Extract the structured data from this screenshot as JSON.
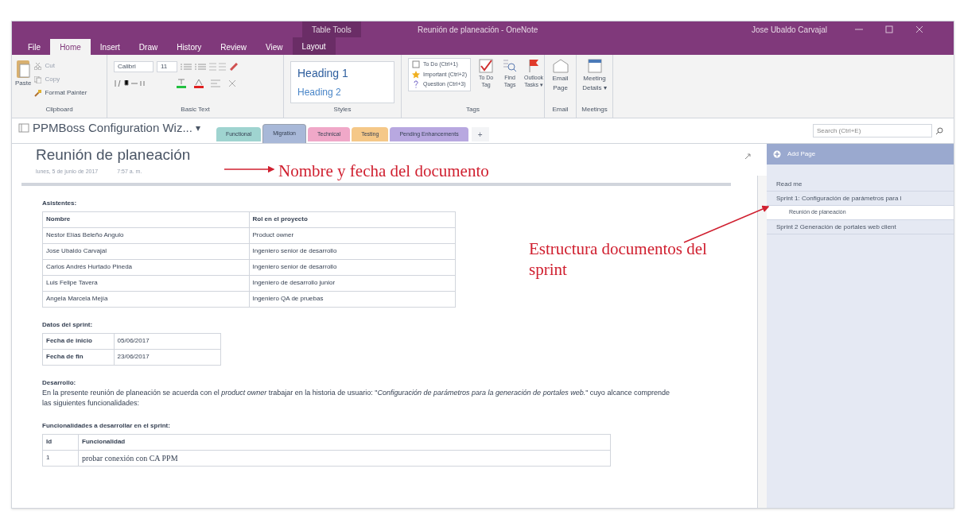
{
  "window": {
    "title": "Reunión de planeación - OneNote",
    "context_group": "Table Tools",
    "user": "Jose Ubaldo Carvajal"
  },
  "ribbon_tabs": [
    {
      "label": "File",
      "selected": false
    },
    {
      "label": "Home",
      "selected": true
    },
    {
      "label": "Insert",
      "selected": false
    },
    {
      "label": "Draw",
      "selected": false
    },
    {
      "label": "History",
      "selected": false
    },
    {
      "label": "Review",
      "selected": false
    },
    {
      "label": "View",
      "selected": false
    },
    {
      "label": "Layout",
      "selected": false
    }
  ],
  "ribbon": {
    "clipboard": {
      "paste": "Paste",
      "cut": "Cut",
      "copy": "Copy",
      "format_painter": "Format Painter",
      "label": "Clipboard"
    },
    "basic_text": {
      "font": "Calibri",
      "size": "11",
      "label": "Basic Text"
    },
    "styles": {
      "items": [
        "Heading 1",
        "Heading 2"
      ],
      "label": "Styles"
    },
    "tags": {
      "items": [
        {
          "kind": "todo",
          "label": "To Do (Ctrl+1)"
        },
        {
          "kind": "important",
          "label": "Important (Ctrl+2)"
        },
        {
          "kind": "question",
          "label": "Question (Ctrl+3)"
        }
      ],
      "buttons": [
        {
          "kind": "todo",
          "label": "To Do Tag"
        },
        {
          "kind": "find",
          "label": "Find Tags"
        },
        {
          "kind": "flag",
          "label": "Outlook Tasks ▾"
        }
      ],
      "label": "Tags"
    },
    "email": {
      "button": "Email Page",
      "label": "Email"
    },
    "meetings": {
      "button": "Meeting Details ▾",
      "label": "Meetings"
    }
  },
  "notebook": {
    "name": "PPMBoss Configuration Wiz...",
    "dropdown": "▾",
    "sections": [
      {
        "label": "Functional",
        "color": "#9fd4d0",
        "selected": false
      },
      {
        "label": "Migration",
        "color": "#a8b8d8",
        "selected": true
      },
      {
        "label": "Technical",
        "color": "#f0a8c8",
        "selected": false
      },
      {
        "label": "Testing",
        "color": "#f5c888",
        "selected": false
      },
      {
        "label": "Pending Enhancements",
        "color": "#b8a8e0",
        "selected": false
      }
    ],
    "add_section": "+",
    "search_placeholder": "Search (Ctrl+E)"
  },
  "page": {
    "title": "Reunión de planeación",
    "date": "lunes, 5 de junio de 2017",
    "time": "7:57 a. m.",
    "attendees_heading": "Asistentes:",
    "attendees_columns": [
      "Nombre",
      "Rol en el proyecto"
    ],
    "attendees": [
      [
        "Nestor Elías Beleño Angulo",
        "Product owner"
      ],
      [
        "Jose Ubaldo Carvajal",
        "Ingeniero senior de desarrollo"
      ],
      [
        "Carlos Andrés Hurtado Pineda",
        "Ingeniero senior de desarrollo"
      ],
      [
        "Luis Felipe Tavera",
        "Ingeniero de desarrollo junior"
      ],
      [
        "Angela Marcela Mejía",
        "Ingeniero QA de pruebas"
      ]
    ],
    "sprint_heading": "Datos del sprint:",
    "sprint_rows": [
      [
        "Fecha de inicio",
        "05/06/2017"
      ],
      [
        "Fecha de fin",
        "23/06/2017"
      ]
    ],
    "development_heading": "Desarrollo:",
    "development_text": "En la presente reunión de planeación se acuerda con el *product owner* trabajar en la historia de usuario: \"*Configuración de parámetros para la generación de portales web.*\" cuyo alcance comprende las siguientes funcionalidades:",
    "features_heading": "Funcionalidades a desarrollar en el sprint:",
    "features_columns": [
      "Id",
      "Funcionalidad"
    ],
    "features": [
      [
        "1",
        "probar conexión con CA PPM"
      ]
    ]
  },
  "pages_panel": {
    "add_page": "Add Page",
    "pages": [
      {
        "label": "Read me",
        "selected": false
      },
      {
        "label": "Sprint 1: Configuración de parámetros para l",
        "selected": false,
        "children": [
          {
            "label": "Reunión de planeación",
            "selected": true
          }
        ]
      },
      {
        "label": "Sprint 2 Generación de portales web client",
        "selected": false
      }
    ]
  },
  "annotations": [
    "Nombre y fecha del documento",
    "Estructura documentos del sprint"
  ]
}
